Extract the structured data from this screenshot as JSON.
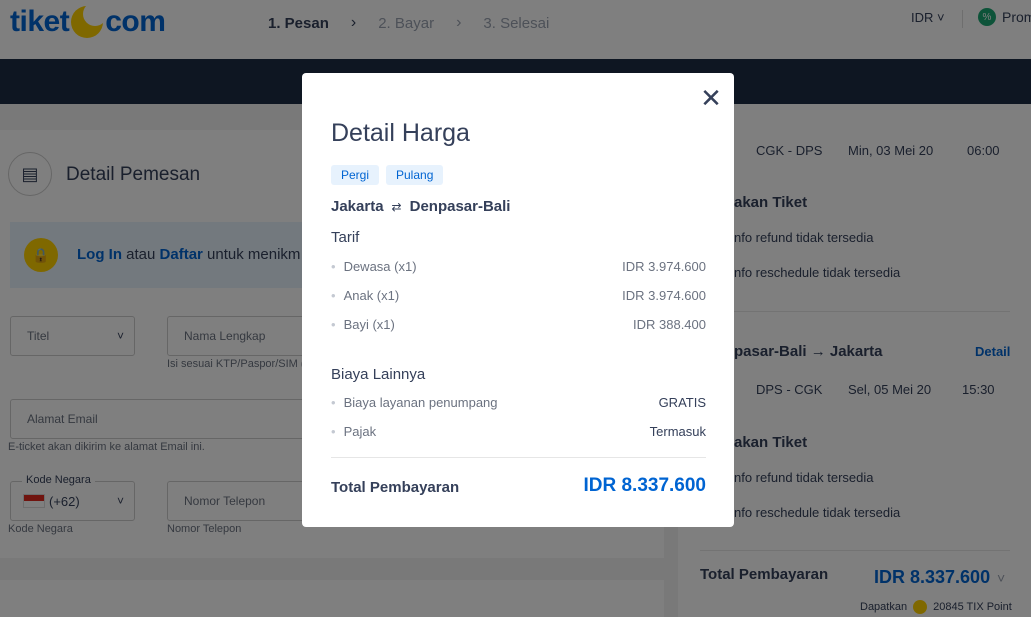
{
  "header": {
    "logo_left": "tiket",
    "logo_right": "com",
    "steps": [
      "1. Pesan",
      "2. Bayar",
      "3. Selesai"
    ],
    "currency": "IDR ˅",
    "promo": "Prom"
  },
  "left": {
    "section_title": "Detail Pemesan",
    "login_link": "Log In",
    "login_mid": " atau ",
    "register_link": "Daftar",
    "login_rest": " untuk menikm",
    "title_field": "Titel",
    "name_field": "Nama Lengkap",
    "name_hint": "Isi sesuai KTP/Paspor/SIM (",
    "email_field": "Alamat Email",
    "email_hint": "E-ticket akan dikirim ke alamat Email ini.",
    "country_legend": "Kode Negara",
    "country_code": "(+62)",
    "country_hint": "Kode Negara",
    "phone_field": "Nomor Telepon",
    "phone_hint": "Nomor Telepon"
  },
  "right": {
    "flight1": {
      "route": "CGK - DPS",
      "date": "Min, 03 Mei 20",
      "time": "06:00"
    },
    "ticket_head1": "akan Tiket",
    "refund1": "nfo refund tidak tersedia",
    "reschedule1": "nfo reschedule tidak tersedia",
    "return_route": "pasar-Bali → Jakarta",
    "detail_link": "Detail",
    "flight2": {
      "route": "DPS - CGK",
      "date": "Sel, 05 Mei 20",
      "time": "15:30"
    },
    "ticket_head2": "akan Tiket",
    "refund2": "nfo refund tidak tersedia",
    "reschedule2": "nfo reschedule tidak tersedia",
    "total_label": "Total Pembayaran",
    "total_value": "IDR 8.337.600",
    "tix_prefix": "Dapatkan",
    "tix_points": "20845 TIX Point"
  },
  "modal": {
    "title": "Detail Harga",
    "tags": [
      "Pergi",
      "Pulang"
    ],
    "origin": "Jakarta",
    "destination": "Denpasar-Bali",
    "tarif_heading": "Tarif",
    "tarif": [
      {
        "label": "Dewasa (x1)",
        "value": "IDR 3.974.600"
      },
      {
        "label": "Anak (x1)",
        "value": "IDR 3.974.600"
      },
      {
        "label": "Bayi (x1)",
        "value": "IDR 388.400"
      }
    ],
    "other_heading": "Biaya Lainnya",
    "other": [
      {
        "label": "Biaya layanan penumpang",
        "value": "GRATIS"
      },
      {
        "label": "Pajak",
        "value": "Termasuk"
      }
    ],
    "total_label": "Total Pembayaran",
    "total_value": "IDR 8.337.600"
  },
  "colors": {
    "brand": "#0064d2",
    "accent": "#ffd100",
    "banner": "#1c2c44"
  }
}
